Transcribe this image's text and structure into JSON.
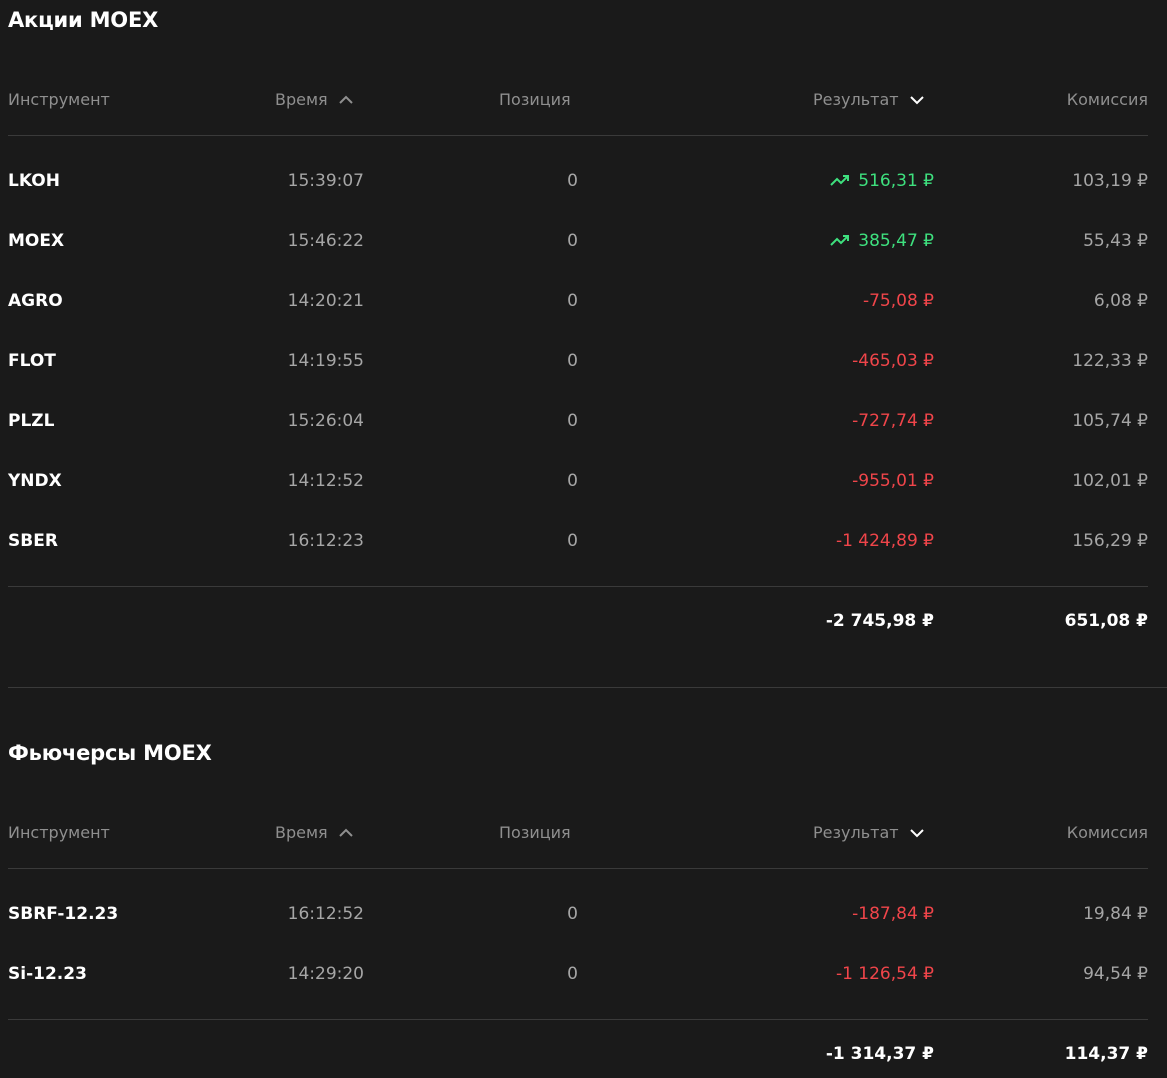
{
  "colors": {
    "background": "#1a1a1a",
    "positive": "#3ee07e",
    "negative": "#f0454a",
    "muted": "#8f8f8f"
  },
  "sections": [
    {
      "title": "Акции MOEX",
      "headers": {
        "instrument": "Инструмент",
        "time": "Время",
        "position": "Позиция",
        "result": "Результат",
        "commission": "Комиссия"
      },
      "rows": [
        {
          "instrument": "LKOH",
          "time": "15:39:07",
          "position": "0",
          "result": "516,31 ₽",
          "commission": "103,19 ₽",
          "trend": "up"
        },
        {
          "instrument": "MOEX",
          "time": "15:46:22",
          "position": "0",
          "result": "385,47 ₽",
          "commission": "55,43 ₽",
          "trend": "up"
        },
        {
          "instrument": "AGRO",
          "time": "14:20:21",
          "position": "0",
          "result": "-75,08 ₽",
          "commission": "6,08 ₽",
          "trend": "down"
        },
        {
          "instrument": "FLOT",
          "time": "14:19:55",
          "position": "0",
          "result": "-465,03 ₽",
          "commission": "122,33 ₽",
          "trend": "down"
        },
        {
          "instrument": "PLZL",
          "time": "15:26:04",
          "position": "0",
          "result": "-727,74 ₽",
          "commission": "105,74 ₽",
          "trend": "down"
        },
        {
          "instrument": "YNDX",
          "time": "14:12:52",
          "position": "0",
          "result": "-955,01 ₽",
          "commission": "102,01 ₽",
          "trend": "down"
        },
        {
          "instrument": "SBER",
          "time": "16:12:23",
          "position": "0",
          "result": "-1 424,89 ₽",
          "commission": "156,29 ₽",
          "trend": "down"
        }
      ],
      "totals": {
        "result": "-2 745,98 ₽",
        "commission": "651,08 ₽"
      }
    },
    {
      "title": "Фьючерсы MOEX",
      "headers": {
        "instrument": "Инструмент",
        "time": "Время",
        "position": "Позиция",
        "result": "Результат",
        "commission": "Комиссия"
      },
      "rows": [
        {
          "instrument": "SBRF-12.23",
          "time": "16:12:52",
          "position": "0",
          "result": "-187,84 ₽",
          "commission": "19,84 ₽",
          "trend": "down"
        },
        {
          "instrument": "Si-12.23",
          "time": "14:29:20",
          "position": "0",
          "result": "-1 126,54 ₽",
          "commission": "94,54 ₽",
          "trend": "down"
        }
      ],
      "totals": {
        "result": "-1 314,37 ₽",
        "commission": "114,37 ₽"
      }
    }
  ]
}
